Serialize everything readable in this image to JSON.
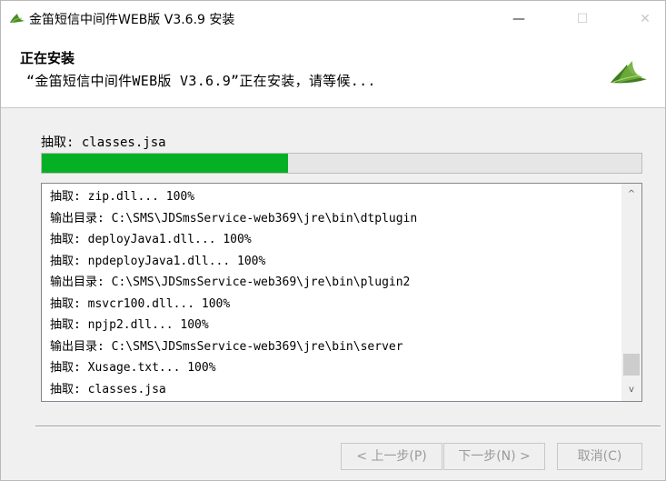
{
  "window": {
    "title": "金笛短信中间件WEB版 V3.6.9 安装",
    "controls": {
      "minimize": "—",
      "maximize": "☐",
      "close": "✕"
    },
    "icon": "jd-leaf-icon"
  },
  "header": {
    "title": "正在安装",
    "subtitle": "“金笛短信中间件WEB版 V3.6.9”正在安装，请等候...",
    "logo": "jd-leaf-logo"
  },
  "status": {
    "text": "抽取: classes.jsa",
    "progress": 0.41
  },
  "log": {
    "lines": [
      "抽取: zip.dll... 100%",
      "输出目录: C:\\SMS\\JDSmsService-web369\\jre\\bin\\dtplugin",
      "抽取: deployJava1.dll... 100%",
      "抽取: npdeployJava1.dll... 100%",
      "输出目录: C:\\SMS\\JDSmsService-web369\\jre\\bin\\plugin2",
      "抽取: msvcr100.dll... 100%",
      "抽取: npjp2.dll... 100%",
      "输出目录: C:\\SMS\\JDSmsService-web369\\jre\\bin\\server",
      "抽取: Xusage.txt... 100%",
      "抽取: classes.jsa"
    ],
    "scroll_up": "^",
    "scroll_down": "v"
  },
  "buttons": {
    "back": "< 上一步(P)",
    "next": "下一步(N) >",
    "cancel": "取消(C)"
  },
  "colors": {
    "progress_fill": "#06b025",
    "logo_green": "#4a8a2a"
  }
}
